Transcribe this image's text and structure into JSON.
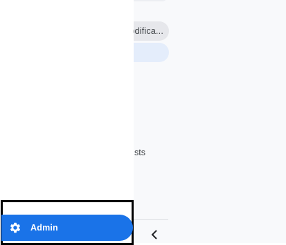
{
  "background": {
    "chip_text": "odifica...",
    "partial_text": "sts"
  },
  "drawer": {
    "admin_label": "Admin"
  },
  "icons": {
    "admin": "gear-icon",
    "back": "chevron-left-icon"
  },
  "colors": {
    "accent": "#1a73e8",
    "background": "#f8f9fb",
    "drawer": "#ffffff"
  }
}
